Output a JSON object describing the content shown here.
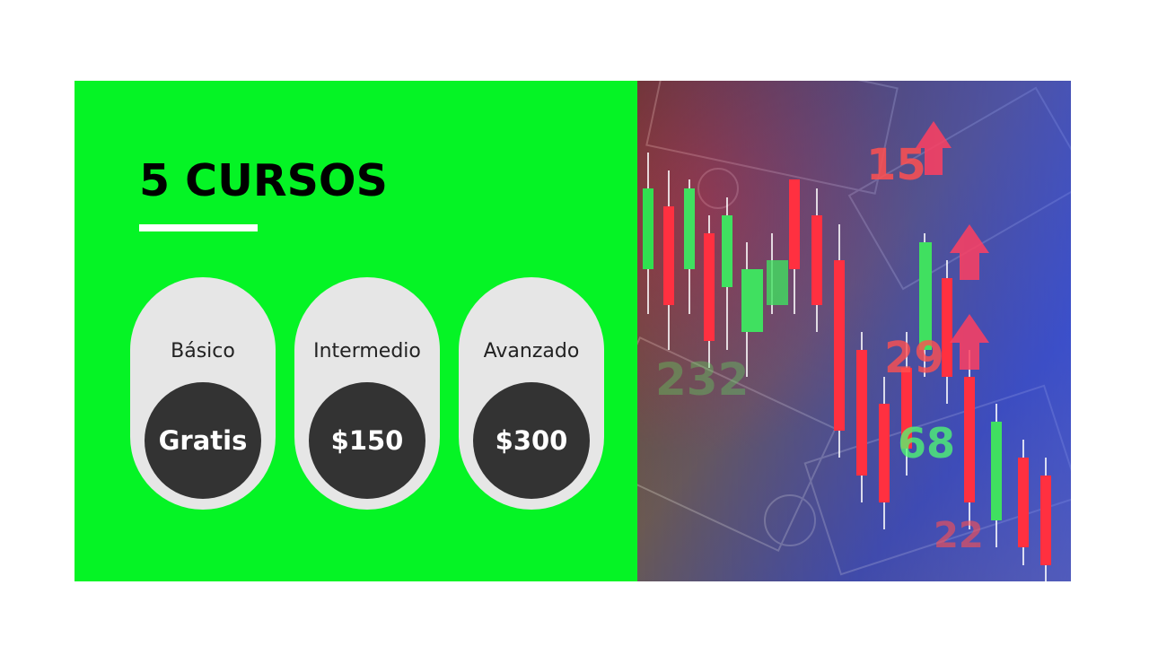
{
  "slide": {
    "title": "5 CURSOS",
    "colors": {
      "panel": "#05f425",
      "card": "#e6e6e6",
      "price_circle": "#333333",
      "title": "#000000",
      "underline": "#ffffff"
    }
  },
  "courses": [
    {
      "level": "Básico",
      "price": "Gratis"
    },
    {
      "level": "Intermedio",
      "price": "$150"
    },
    {
      "level": "Avanzado",
      "price": "$300"
    }
  ],
  "image": {
    "subject": "stock-market-candlestick-over-dollar-bills-photo",
    "overlay_numbers": [
      "15",
      "29",
      "68",
      "232",
      "22"
    ]
  }
}
